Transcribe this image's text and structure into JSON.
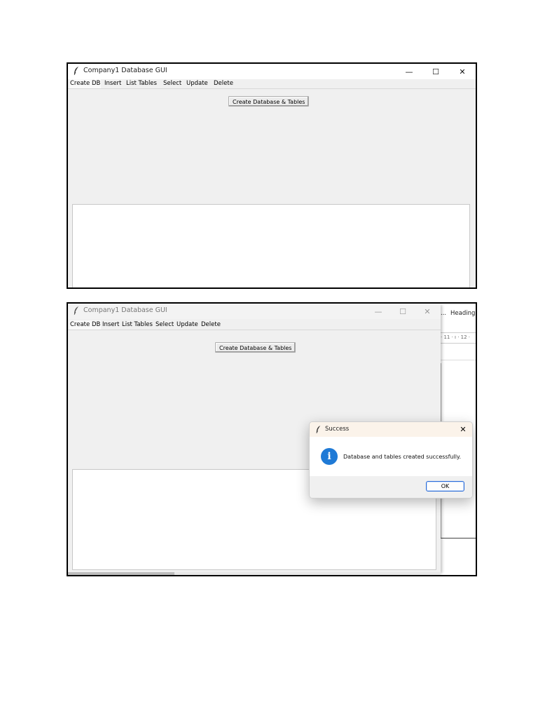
{
  "window": {
    "title": "Company1 Database GUI",
    "minimize_glyph": "—",
    "maximize_glyph": "☐",
    "close_glyph": "✕"
  },
  "tabs": [
    "Create DB",
    "Insert",
    "List Tables",
    "Select",
    "Update",
    "Delete"
  ],
  "active_tab": "Create DB",
  "create_button_label": "Create Database & Tables",
  "background_app": {
    "top_hint": "...",
    "ellipsis": "...",
    "style_label": "Heading",
    "ruler_text": "· 11 · ı · 12 ·"
  },
  "dialog": {
    "title": "Success",
    "icon": "info-icon",
    "icon_glyph": "i",
    "message": "Database and tables created successfully.",
    "ok_label": "OK",
    "close_glyph": "✕"
  },
  "colors": {
    "window_bg": "#f0f0f0",
    "info_icon": "#1f7ad6",
    "ok_border": "#2a6bd8"
  }
}
